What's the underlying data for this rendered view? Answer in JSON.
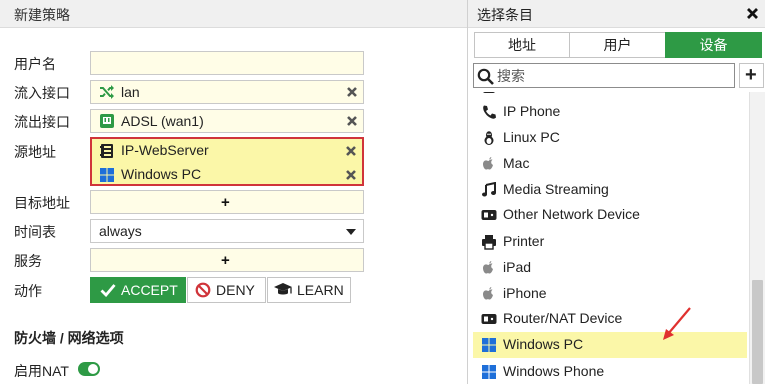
{
  "left_panel": {
    "title": "新建策略",
    "fields": {
      "username_label": "用户名",
      "incoming_label": "流入接口",
      "incoming_value": "lan",
      "outgoing_label": "流出接口",
      "outgoing_value": "ADSL (wan1)",
      "source_label": "源地址",
      "source_items": [
        "IP-WebServer",
        "Windows PC"
      ],
      "dest_label": "目标地址",
      "schedule_label": "时间表",
      "schedule_value": "always",
      "service_label": "服务",
      "action_label": "动作",
      "actions": [
        "ACCEPT",
        "DENY",
        "LEARN"
      ]
    },
    "firewall_section_title": "防火墙 / 网络选项",
    "nat_label": "启用NAT",
    "nat_enabled": true
  },
  "right_panel": {
    "title": "选择条目",
    "tabs": [
      "地址",
      "用户",
      "设备"
    ],
    "active_tab": "设备",
    "search_placeholder": "搜索",
    "items": [
      {
        "label": "IP Phone",
        "icon": "phone-icon"
      },
      {
        "label": "Linux PC",
        "icon": "linux-icon"
      },
      {
        "label": "Mac",
        "icon": "apple-icon"
      },
      {
        "label": "Media Streaming",
        "icon": "music-icon"
      },
      {
        "label": "Other Network Device",
        "icon": "network-device-icon"
      },
      {
        "label": "Printer",
        "icon": "printer-icon"
      },
      {
        "label": "iPad",
        "icon": "apple-icon"
      },
      {
        "label": "iPhone",
        "icon": "apple-icon"
      },
      {
        "label": "Router/NAT Device",
        "icon": "router-icon"
      },
      {
        "label": "Windows PC",
        "icon": "windows-icon",
        "selected": true
      },
      {
        "label": "Windows Phone",
        "icon": "windows-icon"
      }
    ]
  },
  "colors": {
    "accent_green": "#2e9a45",
    "field_yellow": "#fffde7",
    "highlight_yellow": "#fbf7a8",
    "highlight_border_red": "#d0343a",
    "windows_blue": "#1e6fd9",
    "arrow_red": "#e0312f"
  }
}
